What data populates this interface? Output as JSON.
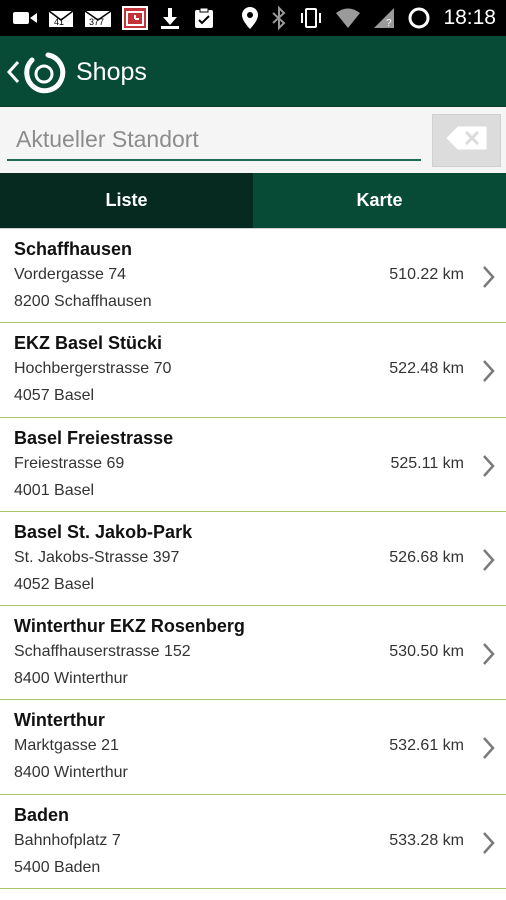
{
  "status_bar": {
    "time": "18:18",
    "badge_a": "41",
    "badge_b": "377",
    "icons": [
      "video-icon",
      "mail-icon",
      "gmail-icon",
      "calendar-icon",
      "download-icon",
      "clipboard-icon",
      "location-icon",
      "bluetooth-icon",
      "vibrate-icon",
      "wifi-icon",
      "signal-icon",
      "battery-circle-icon"
    ]
  },
  "app_bar": {
    "title": "Shops",
    "colors": {
      "background": "#074a36",
      "text": "#ffffff"
    }
  },
  "search": {
    "placeholder": "Aktueller Standort",
    "value": ""
  },
  "tabs": [
    {
      "label": "Liste",
      "active": true
    },
    {
      "label": "Karte",
      "active": false
    }
  ],
  "shops": [
    {
      "name": "Schaffhausen",
      "street": "Vordergasse 74",
      "city": "8200 Schaffhausen",
      "distance": "510.22 km"
    },
    {
      "name": "EKZ Basel Stücki",
      "street": "Hochbergerstrasse 70",
      "city": "4057 Basel",
      "distance": "522.48 km"
    },
    {
      "name": "Basel Freiestrasse",
      "street": "Freiestrasse 69",
      "city": "4001 Basel",
      "distance": "525.11 km"
    },
    {
      "name": "Basel St. Jakob-Park",
      "street": "St. Jakobs-Strasse 397",
      "city": "4052 Basel",
      "distance": "526.68 km"
    },
    {
      "name": "Winterthur EKZ Rosenberg",
      "street": "Schaffhauserstrasse 152",
      "city": "8400 Winterthur",
      "distance": "530.50 km"
    },
    {
      "name": "Winterthur",
      "street": "Marktgasse 21",
      "city": "8400 Winterthur",
      "distance": "532.61 km"
    },
    {
      "name": "Baden",
      "street": "Bahnhofplatz 7",
      "city": "5400 Baden",
      "distance": "533.28 km"
    }
  ],
  "colors": {
    "primary": "#074a36",
    "tab_active": "#062a1f",
    "divider": "#a9c46a",
    "accent_underline": "#1f6b57"
  }
}
